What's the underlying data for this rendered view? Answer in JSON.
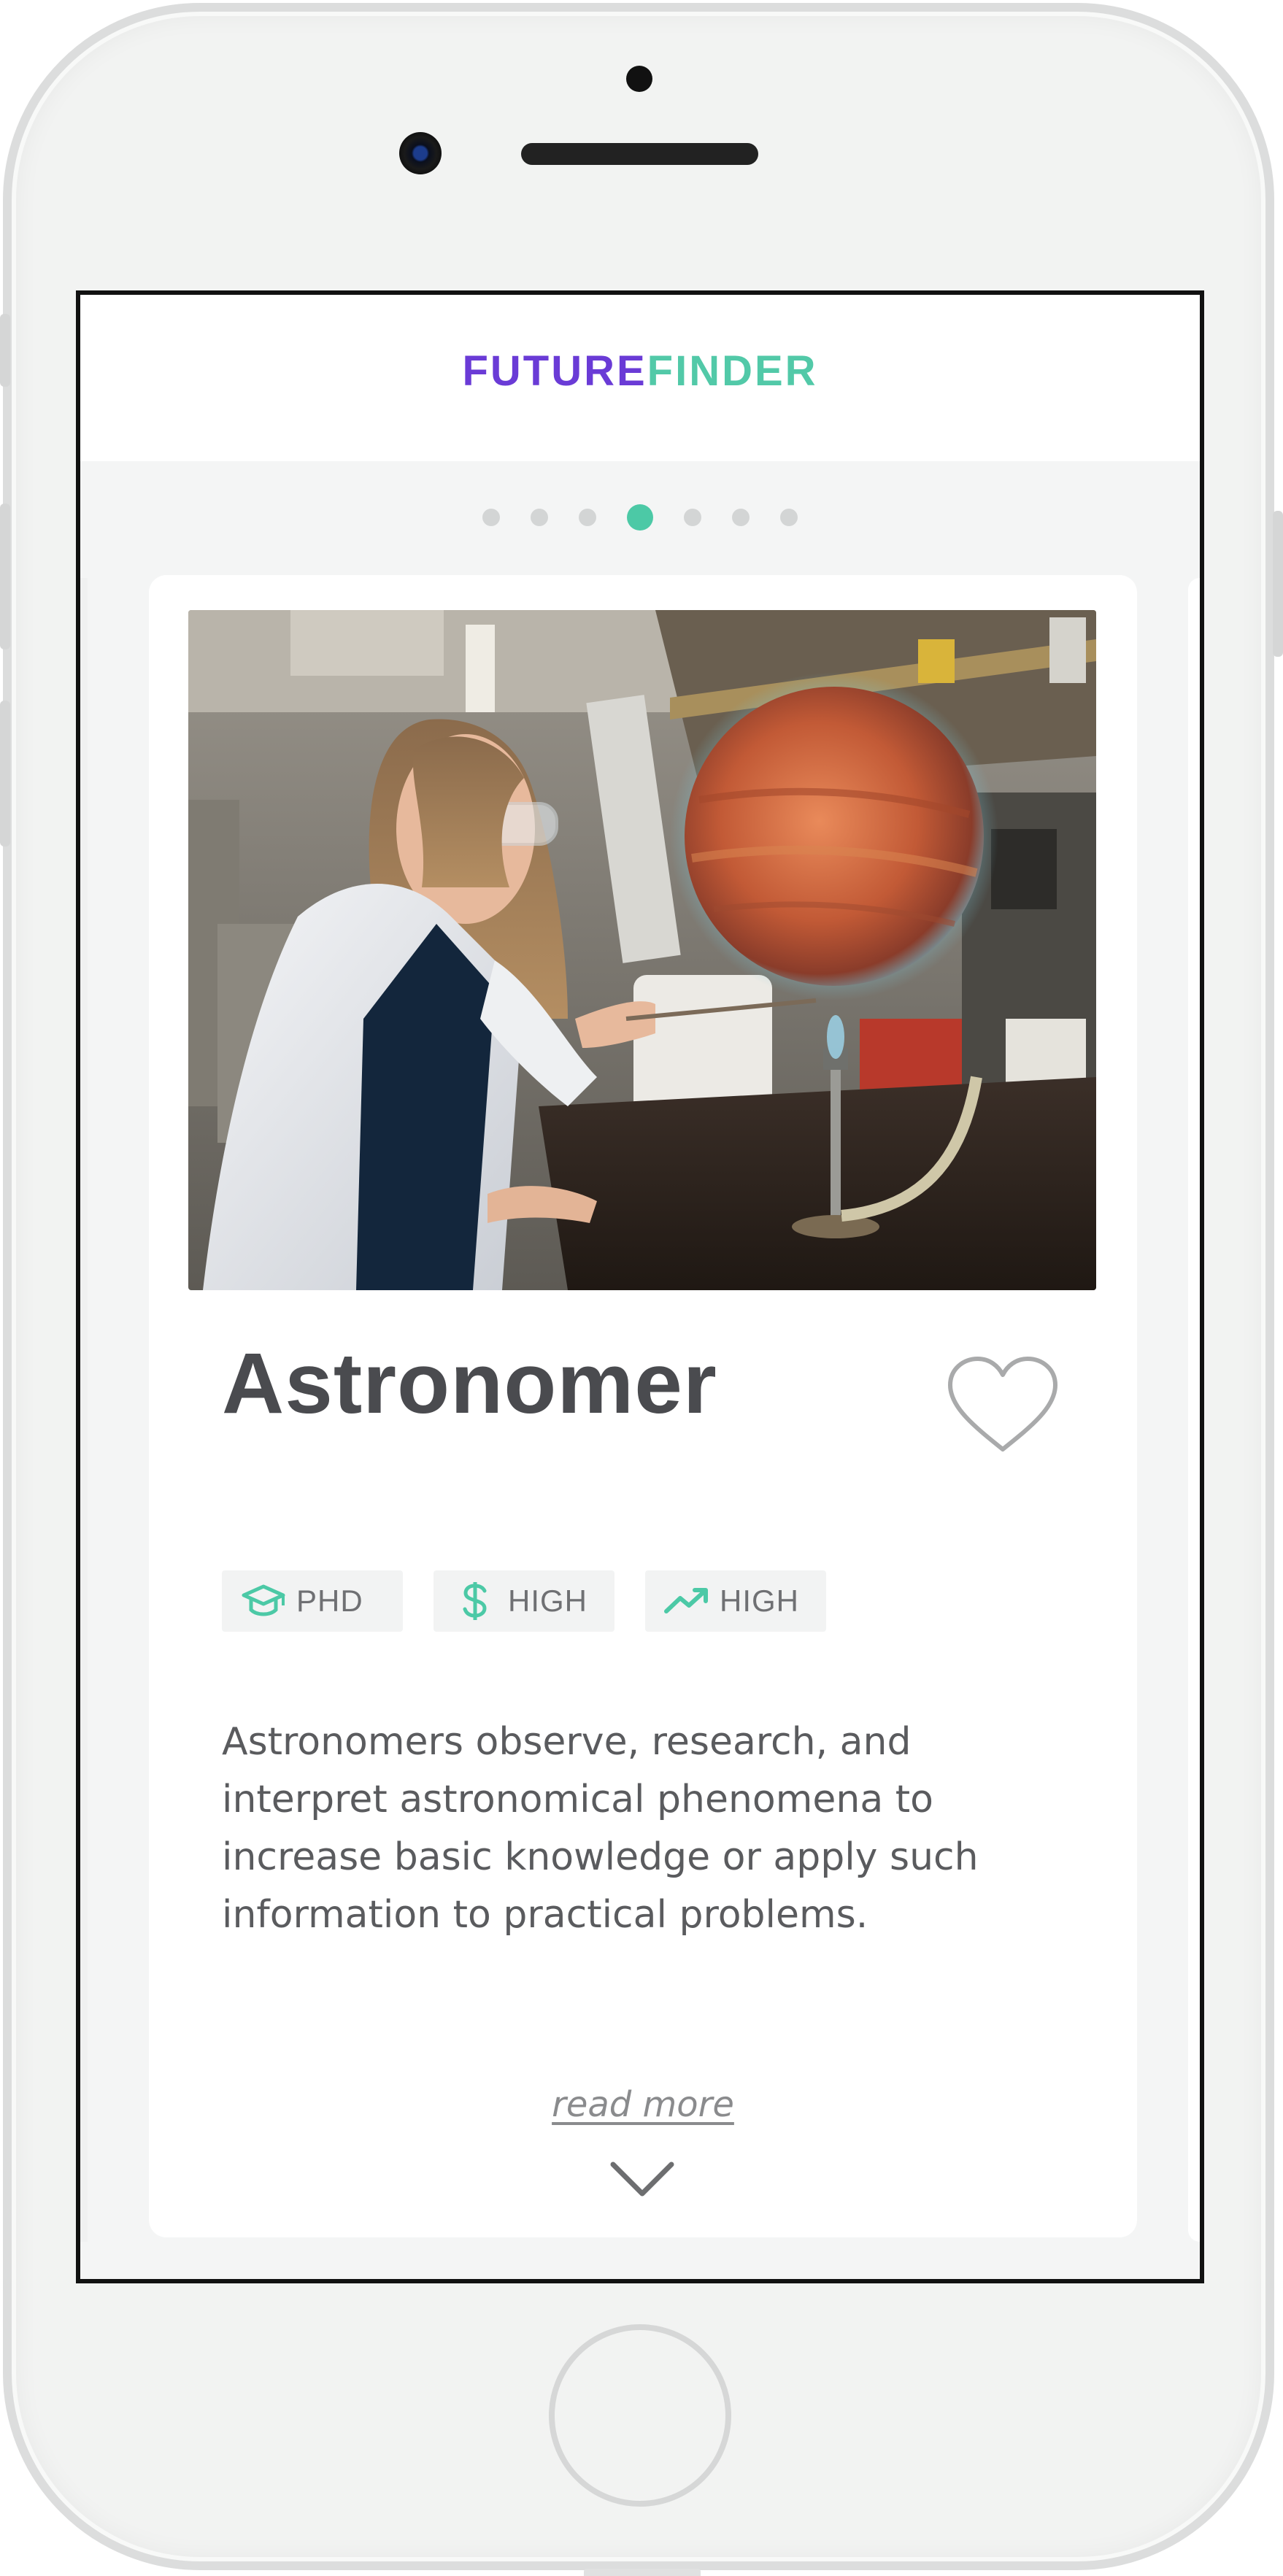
{
  "header": {
    "logo_part1": "FUTURE",
    "logo_part2": "FINDER"
  },
  "pager": {
    "total": 7,
    "active_index": 3
  },
  "card": {
    "title": "Astronomer",
    "image_alt": "Scientist in lab coat and safety goggles examining a glowing orange planet above a burner",
    "favorited": false,
    "badges": [
      {
        "icon": "graduation-cap-icon",
        "label": "PHD"
      },
      {
        "icon": "dollar-sign-icon",
        "label": "HIGH"
      },
      {
        "icon": "trending-up-icon",
        "label": "HIGH"
      }
    ],
    "description": "Astronomers observe, research, and interpret astronomical phenomena to increase basic knowledge or apply such information to practical problems.",
    "read_more": "read more"
  },
  "colors": {
    "brand_purple": "#6a3bd6",
    "brand_teal": "#52c9a8",
    "accent": "#4cc9a6",
    "title_text": "#4a4b4f",
    "body_text": "#5a5b5e"
  }
}
